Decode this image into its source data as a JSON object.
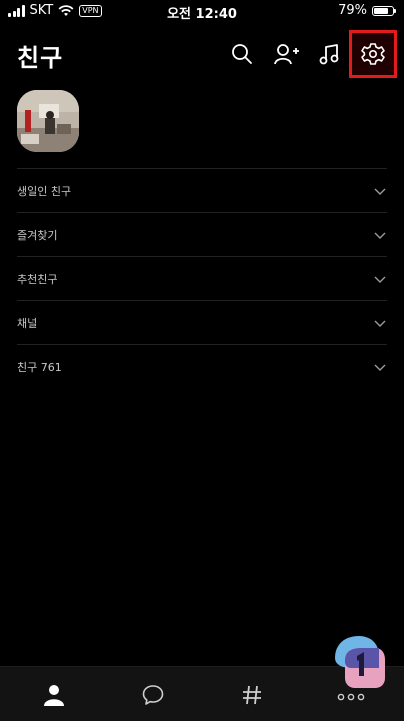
{
  "status_bar": {
    "carrier": "SKT",
    "vpn": "VPN",
    "time": "오전 12:40",
    "battery": "79%",
    "battery_level": 0.79
  },
  "header": {
    "title": "친구"
  },
  "sections": [
    {
      "label": "생일인 친구"
    },
    {
      "label": "즐겨찾기"
    },
    {
      "label": "추천친구"
    },
    {
      "label": "채널"
    },
    {
      "label": "친구 761"
    }
  ],
  "colors": {
    "background": "#000000",
    "highlight": "#e21c1c",
    "nav_background": "#131313"
  },
  "icons": {
    "header": [
      "search-icon",
      "add-friend-icon",
      "music-icon",
      "settings-icon"
    ],
    "nav": [
      "friends-icon",
      "chat-icon",
      "hashtag-icon",
      "more-icon"
    ]
  }
}
